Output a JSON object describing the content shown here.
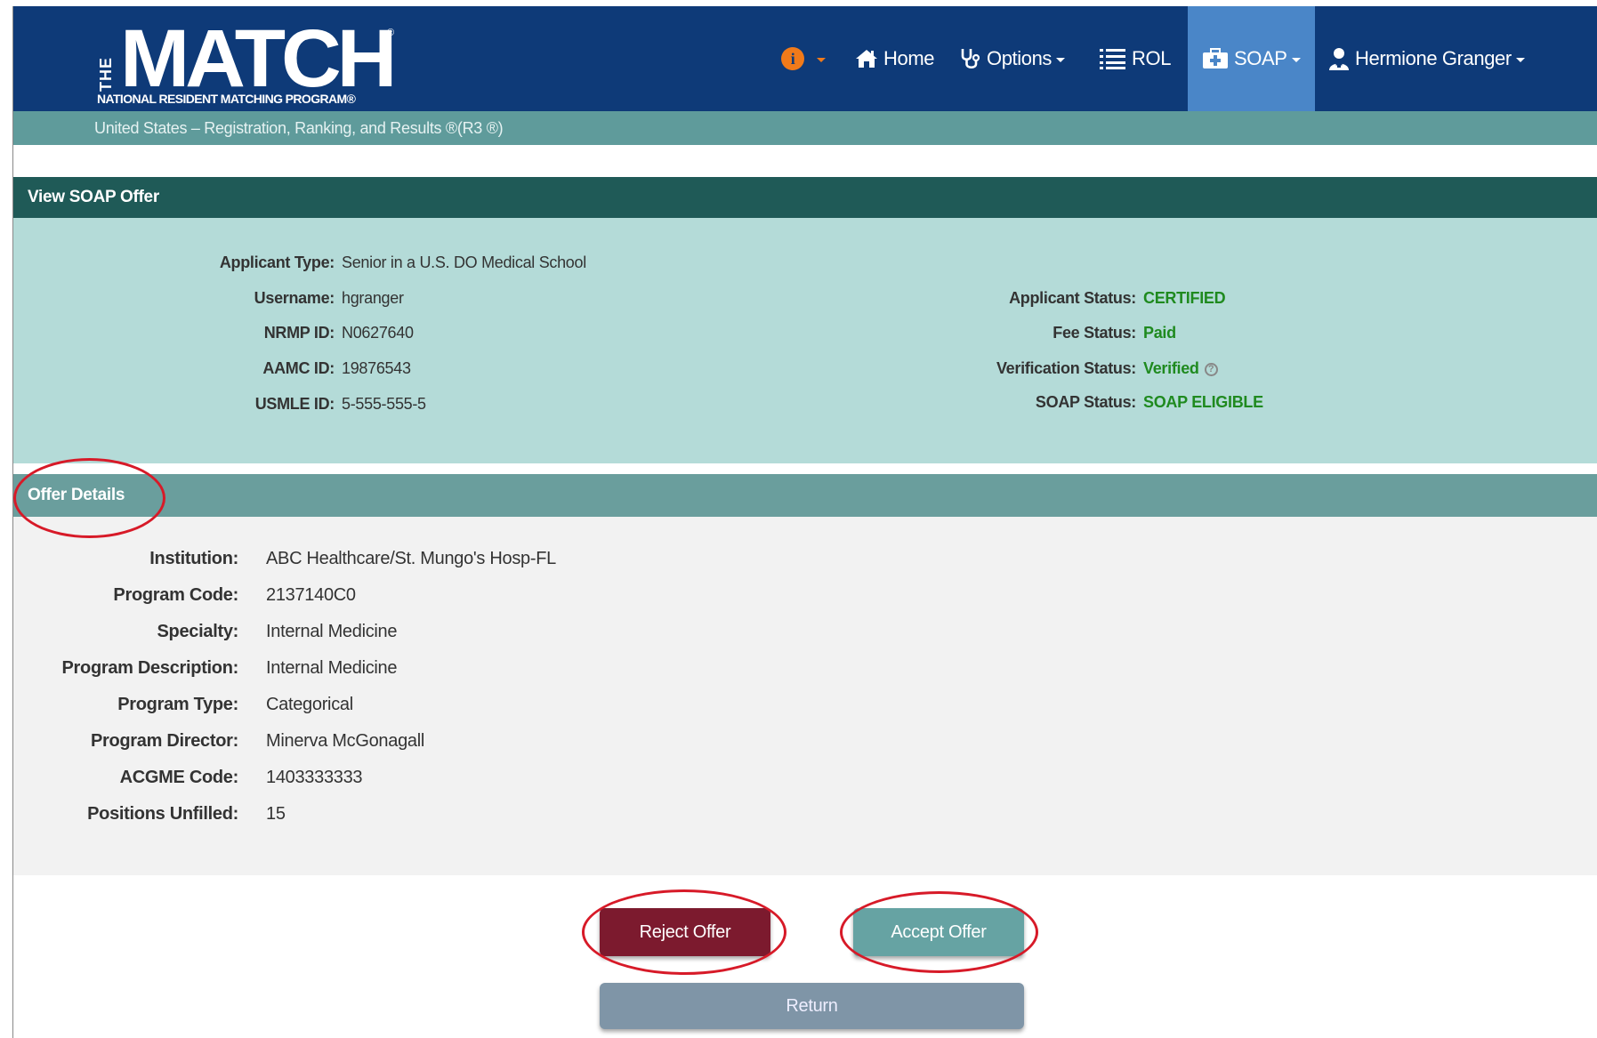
{
  "header": {
    "logo_the": "THE",
    "logo_word": "MATCH",
    "logo_registered": "®",
    "logo_subtitle": "NATIONAL RESIDENT MATCHING PROGRAM®",
    "nav": {
      "info_icon": "info-icon",
      "home_label": "Home",
      "options_label": "Options",
      "rol_label": "ROL",
      "soap_label": "SOAP",
      "user_label": "Hermione Granger"
    },
    "subbar_text": "United States  – Registration, Ranking, and Results ®(R3 ®)"
  },
  "soap_offer": {
    "title": "View SOAP Offer",
    "left": [
      {
        "label": "Applicant Type:",
        "value": "Senior in a U.S. DO Medical School"
      },
      {
        "label": "Username:",
        "value": "hgranger"
      },
      {
        "label": "NRMP ID:",
        "value": "N0627640"
      },
      {
        "label": "AAMC ID:",
        "value": "19876543"
      },
      {
        "label": "USMLE ID:",
        "value": "5-555-555-5"
      }
    ],
    "right": [
      {
        "label": "Applicant Status:",
        "value": "CERTIFIED"
      },
      {
        "label": "Fee Status:",
        "value": "Paid"
      },
      {
        "label": "Verification Status:",
        "value": "Verified"
      },
      {
        "label": "SOAP Status:",
        "value": "SOAP ELIGIBLE"
      }
    ]
  },
  "offer_details": {
    "title": "Offer Details",
    "rows": [
      {
        "label": "Institution:",
        "value": "ABC Healthcare/St. Mungo's Hosp-FL"
      },
      {
        "label": "Program Code:",
        "value": "2137140C0"
      },
      {
        "label": "Specialty:",
        "value": "Internal Medicine"
      },
      {
        "label": "Program Description:",
        "value": "Internal Medicine"
      },
      {
        "label": "Program Type:",
        "value": "Categorical"
      },
      {
        "label": "Program Director:",
        "value": "Minerva McGonagall"
      },
      {
        "label": "ACGME Code:",
        "value": "1403333333"
      },
      {
        "label": "Positions Unfilled:",
        "value": "15"
      }
    ]
  },
  "actions": {
    "reject_label": "Reject Offer",
    "accept_label": "Accept Offer",
    "return_label": "Return"
  },
  "colors": {
    "navbar": "#0e3a78",
    "subbar": "#5f9b9b",
    "panel_head": "#1f5a57",
    "panel_body": "#b4dbd8",
    "offer_head": "#6a9e9d",
    "status_green": "#1f8a1f",
    "reject": "#7c1a2e",
    "accept": "#66a3a3",
    "return": "#7f95a7",
    "highlight_ring": "#d71a28"
  }
}
